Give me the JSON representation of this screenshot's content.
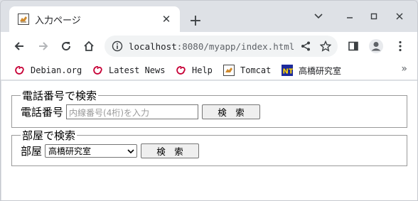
{
  "tab": {
    "title": "入力ページ"
  },
  "address": {
    "host": "localhost",
    "rest": ":8080/myapp/index.html"
  },
  "bookmarks": [
    {
      "label": "Debian.org",
      "icon": "debian-swirl-icon"
    },
    {
      "label": "Latest News",
      "icon": "debian-swirl-icon"
    },
    {
      "label": "Help",
      "icon": "debian-swirl-icon"
    },
    {
      "label": "Tomcat",
      "icon": "tomcat-icon"
    },
    {
      "label": "高橋研究室",
      "icon": "nt-icon"
    }
  ],
  "bookmarks_more": "»",
  "phone_search": {
    "legend": "電話番号で検索",
    "label": "電話番号",
    "placeholder": "内線番号(4桁)を入力",
    "button": "検　索"
  },
  "room_search": {
    "legend": "部屋で検索",
    "label": "部屋",
    "selected": "高橋研究室",
    "button": "検　索"
  }
}
